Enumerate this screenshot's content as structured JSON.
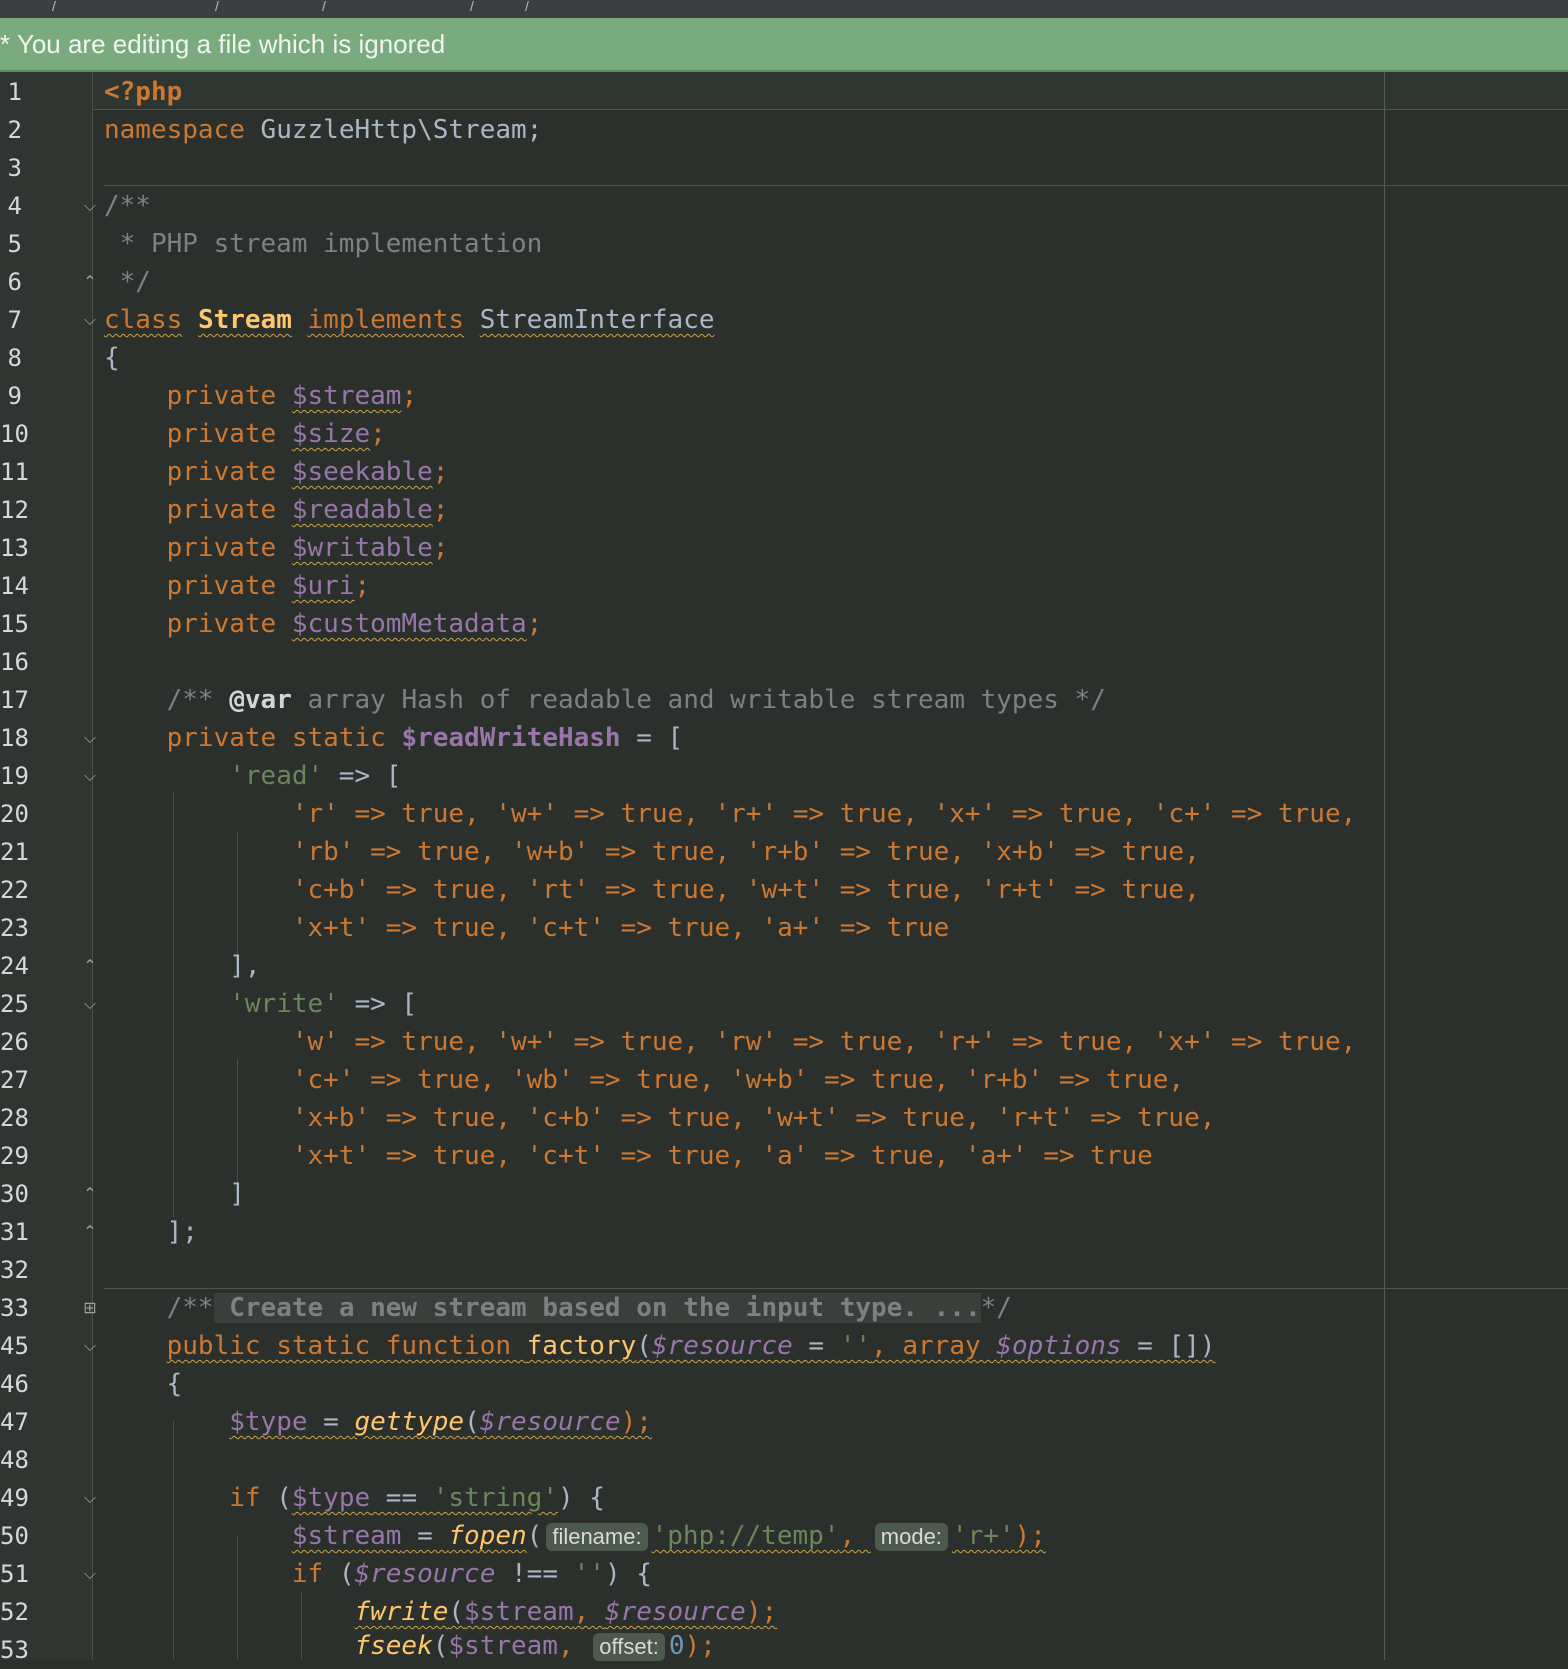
{
  "topbar": {
    "crumbs": [
      "/",
      "/",
      "/",
      "/",
      "/"
    ]
  },
  "notice": {
    "text": "* You are editing a file which is ignored"
  },
  "line_numbers": [
    "1",
    "2",
    "3",
    "4",
    "5",
    "6",
    "7",
    "8",
    "9",
    "10",
    "11",
    "12",
    "13",
    "14",
    "15",
    "16",
    "17",
    "18",
    "19",
    "20",
    "21",
    "22",
    "23",
    "24",
    "25",
    "26",
    "27",
    "28",
    "29",
    "30",
    "31",
    "32",
    "33",
    "45",
    "46",
    "47",
    "48",
    "49",
    "50",
    "51",
    "52",
    "53"
  ],
  "code": {
    "l1_php": "<?php",
    "l2_ns_kw": "namespace",
    "l2_ns": "GuzzleHttp\\Stream;",
    "l4": "/**",
    "l5": " * PHP stream implementation",
    "l6": " */",
    "l7_class": "class",
    "l7_name": "Stream",
    "l7_impl": "implements",
    "l7_iface": "StreamInterface",
    "l8": "{",
    "private_kw": "private",
    "props": [
      "$stream",
      "$size",
      "$seekable",
      "$readable",
      "$writable",
      "$uri",
      "$customMetadata"
    ],
    "semi": ";",
    "l17_open": "/** ",
    "l17_ann": "@var",
    "l17_rest": " array Hash of readable and writable stream types */",
    "l18_static": "private static ",
    "l18_var": "$readWriteHash",
    "l18_rest": " = [",
    "l19_key": "'read'",
    "l19_rest": " => [",
    "l20": "'r' => true, 'w+' => true, 'r+' => true, 'x+' => true, 'c+' => true,",
    "l21": "'rb' => true, 'w+b' => true, 'r+b' => true, 'x+b' => true,",
    "l22": "'c+b' => true, 'rt' => true, 'w+t' => true, 'r+t' => true,",
    "l23": "'x+t' => true, 'c+t' => true, 'a+' => true",
    "l24": "],",
    "l25_key": "'write'",
    "l25_rest": " => [",
    "l26": "'w' => true, 'w+' => true, 'rw' => true, 'r+' => true, 'x+' => true,",
    "l27": "'c+' => true, 'wb' => true, 'w+b' => true, 'r+b' => true,",
    "l28": "'x+b' => true, 'c+b' => true, 'w+t' => true, 'r+t' => true,",
    "l29": "'x+t' => true, 'c+t' => true, 'a' => true, 'a+' => true",
    "l30": "]",
    "l31": "];",
    "l33_open": "/**",
    "l33_fold": " Create a new stream based on the input type. ...",
    "l33_close": "*/",
    "l45_kw": "public static function ",
    "l45_fn": "factory",
    "l45_p1": "(",
    "l45_v1": "$resource",
    "l45_p2": " = ",
    "l45_s1": "''",
    "l45_p3": ", array ",
    "l45_v2": "$options",
    "l45_p4": " = [])",
    "l46": "{",
    "l47_v": "$type",
    "l47_eq": " = ",
    "l47_fn": "gettype",
    "l47_p": "(",
    "l47_v2": "$resource",
    "l47_end": ");",
    "l49_if": "if ",
    "l49_p": "(",
    "l49_v": "$type",
    "l49_op": " == ",
    "l49_s": "'string'",
    "l49_end": ") {",
    "l50_v": "$stream",
    "l50_eq": " = ",
    "l50_fn": "fopen",
    "l50_p": "(",
    "l50_hint1": "filename:",
    "l50_s1": "'php://temp'",
    "l50_c": ", ",
    "l50_hint2": "mode:",
    "l50_s2": "'r+'",
    "l50_end": ");",
    "l51_if": "if ",
    "l51_p": "(",
    "l51_v": "$resource",
    "l51_op": " !== ",
    "l51_s": "''",
    "l51_end": ") {",
    "l52_fn": "fwrite",
    "l52_p": "(",
    "l52_v1": "$stream",
    "l52_c": ", ",
    "l52_v2": "$resource",
    "l52_end": ");",
    "l53_fn": "fseek",
    "l53_p": "(",
    "l53_v": "$stream",
    "l53_c": ", ",
    "l53_hint": "offset:",
    "l53_n": "0",
    "l53_end": ");"
  }
}
